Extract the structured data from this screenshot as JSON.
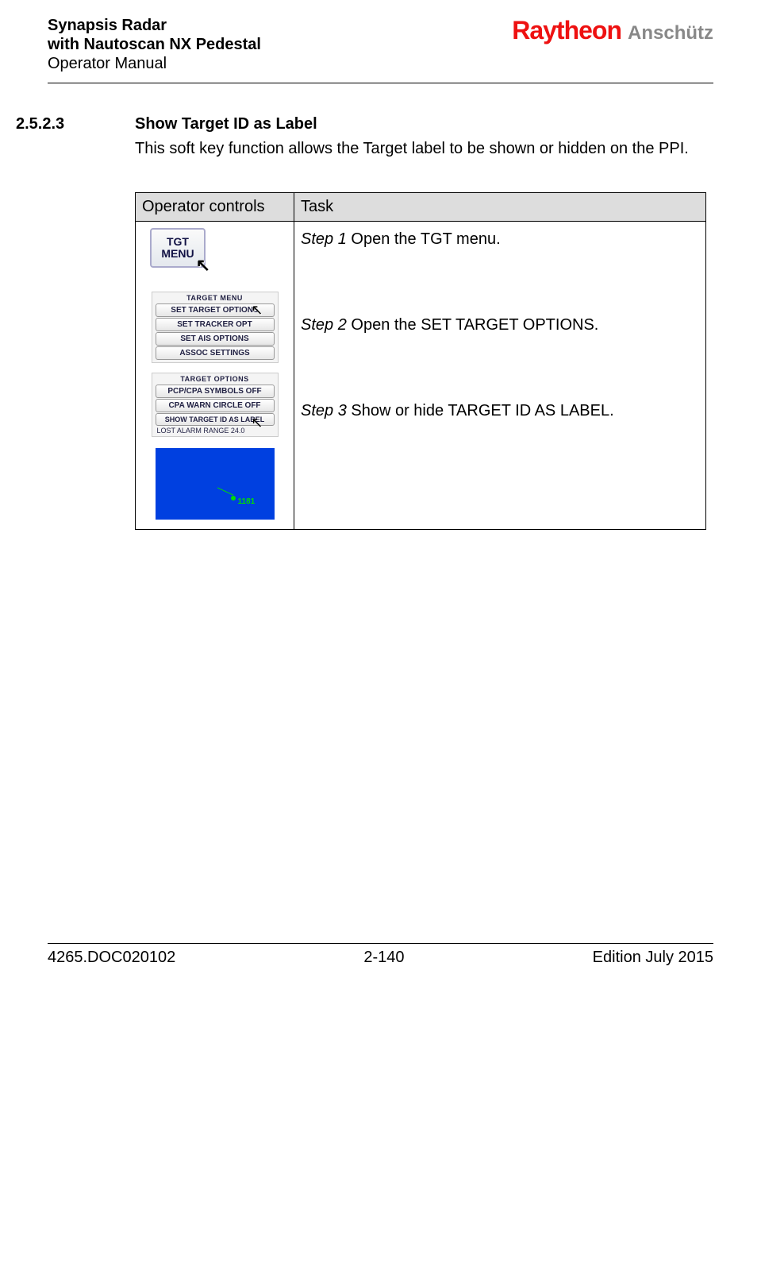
{
  "header": {
    "line1": "Synapsis Radar",
    "line2": "with Nautoscan NX Pedestal",
    "line3": "Operator Manual",
    "brand1": "Raytheon",
    "brand2": "Anschütz"
  },
  "section": {
    "num": "2.5.2.3",
    "title": "Show Target ID as Label",
    "text": "This soft key function allows the Target label to be shown or hidden on the PPI."
  },
  "table": {
    "hdr1": "Operator controls",
    "hdr2": "Task",
    "step1_pre": "Step 1",
    "step1_txt": " Open the TGT menu.",
    "step2_pre": "Step 2",
    "step2_txt": " Open the SET TARGET OPTIONS.",
    "step3_pre": "Step 3",
    "step3_txt": " Show or hide TARGET ID AS LABEL."
  },
  "ui": {
    "tgtbtn_l1": "TGT",
    "tgtbtn_l2": "MENU",
    "menu1_title": "TARGET MENU",
    "menu1_b1": "SET TARGET OPTIONS",
    "menu1_b2": "SET TRACKER OPT",
    "menu1_b3": "SET AIS OPTIONS",
    "menu1_b4": "ASSOC SETTINGS",
    "menu2_title": "TARGET OPTIONS",
    "menu2_b1": "PCP/CPA SYMBOLS OFF",
    "menu2_b2": "CPA WARN CIRCLE OFF",
    "menu2_b3": "SHOW TARGET ID AS LABEL",
    "menu2_b4": "LOST ALARM RANGE    24.0",
    "ppi_label": "1181"
  },
  "footer": {
    "left": "4265.DOC020102",
    "center": "2-140",
    "right": "Edition July 2015"
  }
}
